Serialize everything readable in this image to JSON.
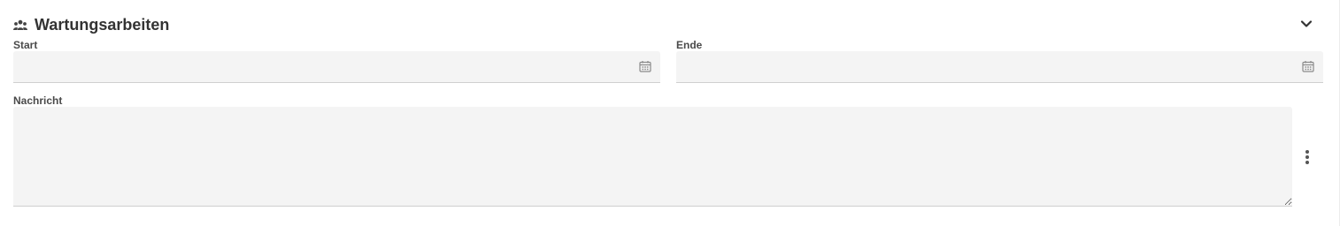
{
  "section": {
    "title": "Wartungsarbeiten",
    "icon": "users-icon",
    "collapse_icon": "chevron-down-icon"
  },
  "fields": {
    "start": {
      "label": "Start",
      "value": "",
      "icon": "calendar-icon"
    },
    "end": {
      "label": "Ende",
      "value": "",
      "icon": "calendar-icon"
    },
    "message": {
      "label": "Nachricht",
      "value": ""
    }
  },
  "actions": {
    "more_icon": "more-vertical-icon"
  },
  "colors": {
    "field_background": "#f4f4f4",
    "title_text": "#333333",
    "label_text": "#4a4a4a"
  }
}
